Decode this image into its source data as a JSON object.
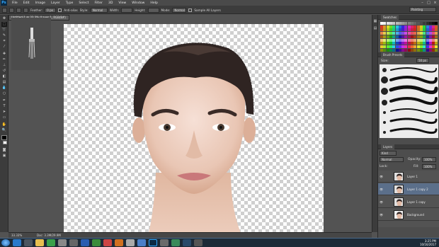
{
  "app": {
    "logo": "Ps"
  },
  "menu": [
    "File",
    "Edit",
    "Image",
    "Layer",
    "Type",
    "Select",
    "Filter",
    "3D",
    "View",
    "Window",
    "Help"
  ],
  "options": {
    "style_label": "Style:",
    "style_value": "Normal",
    "width_label": "Width:",
    "height_label": "Height:",
    "feather_label": "Feather:",
    "feather_value": "0 px",
    "mode_label": "Mode:",
    "mode_value": "Normal",
    "sample_label": "Sample All Layers",
    "antialias_label": "Anti-alias",
    "workspace": "Painting"
  },
  "document": {
    "tab": "Untitled-1 @ 33.3% (Layer 1, RGB/8#)"
  },
  "status": {
    "zoom": "33.33%",
    "doc_size": "Doc: 3.3M/29.9M"
  },
  "panels": {
    "swatches_tab": "Swatches",
    "brush_tab": "Brush Presets",
    "size_label": "Size:",
    "size_value": "50 px",
    "layers_tab": "Layers",
    "kind_label": "Kind",
    "blend_mode": "Normal",
    "opacity_label": "Opacity:",
    "opacity_value": "100%",
    "lock_label": "Lock:",
    "fill_label": "Fill:",
    "fill_value": "100%"
  },
  "layers": [
    {
      "name": "Layer 1",
      "selected": false
    },
    {
      "name": "Layer 1 copy 2",
      "selected": true
    },
    {
      "name": "Layer 1 copy",
      "selected": false
    },
    {
      "name": "Background",
      "selected": false
    }
  ],
  "taskbar": {
    "time": "3:25 PM",
    "date": "10/16/2017"
  },
  "colors": {
    "accent": "#31a8ff",
    "panel": "#4d4d4d",
    "selected_layer": "#5b6f8a"
  }
}
